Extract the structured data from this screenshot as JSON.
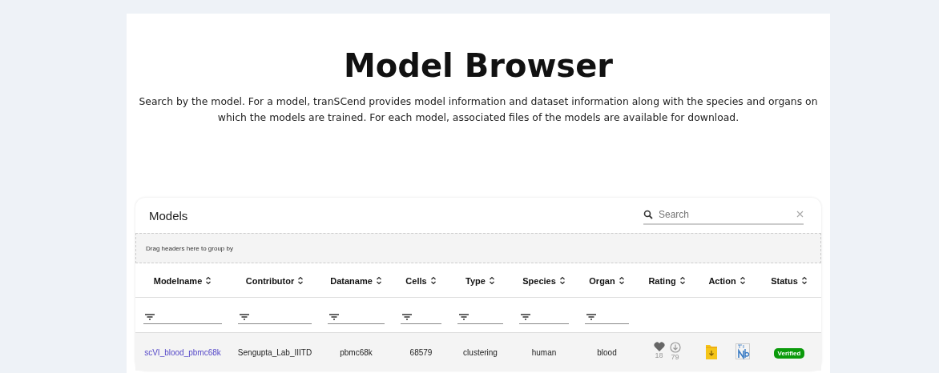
{
  "title": "Model Browser",
  "description": "Search by the model. For a model, tranSCend provides model information and dataset information along with the species and organs on which the models are trained. For each model, associated files of the models are available for download.",
  "grid": {
    "title": "Models",
    "search": {
      "placeholder": "Search"
    },
    "group_hint": "Drag headers here to group by",
    "columns": [
      {
        "label": "Modelname",
        "filter": true
      },
      {
        "label": "Contributor",
        "filter": true
      },
      {
        "label": "Dataname",
        "filter": true
      },
      {
        "label": "Cells",
        "filter": true
      },
      {
        "label": "Type",
        "filter": true
      },
      {
        "label": "Species",
        "filter": true
      },
      {
        "label": "Organ",
        "filter": true
      },
      {
        "label": "Rating",
        "filter": false
      },
      {
        "label": "Action",
        "filter": false
      },
      {
        "label": "Status",
        "filter": false
      }
    ],
    "rows": [
      {
        "modelname": "scVI_blood_pbmc68k",
        "contributor": "Sengupta_Lab_IIITD",
        "dataname": "pbmc68k",
        "cells": "68579",
        "type": "clustering",
        "species": "human",
        "organ": "blood",
        "likes": "18",
        "downloads": "79",
        "status": "Verified"
      }
    ]
  }
}
